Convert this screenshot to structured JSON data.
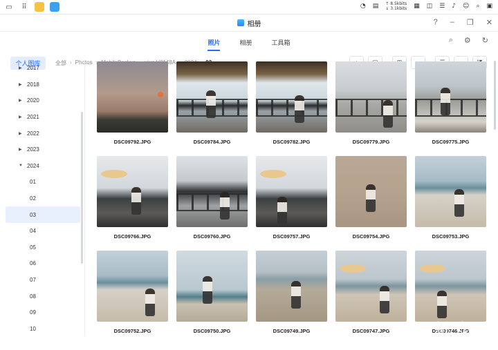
{
  "window": {
    "title": "相册"
  },
  "tabs": [
    {
      "label": "照片",
      "active": true
    },
    {
      "label": "相册",
      "active": false
    },
    {
      "label": "工具箱",
      "active": false
    }
  ],
  "taskbar": {
    "net_up": "↑ 8.5kbits",
    "net_down": "↓ 3.1kbits"
  },
  "sidebar": {
    "library_label": "个人图库",
    "years": [
      "2017",
      "2018",
      "2020",
      "2021",
      "2022",
      "2023",
      "2024"
    ],
    "months_2024": [
      "01",
      "02",
      "03",
      "04",
      "05",
      "06",
      "07",
      "08",
      "09",
      "10"
    ],
    "selected_month": "03"
  },
  "breadcrumb": [
    "全部",
    "Photos",
    "MobileBackup",
    "vivo V2148A",
    "2024",
    "03"
  ],
  "photos": [
    {
      "name": "DSC09792.JPG",
      "scene": "sunset"
    },
    {
      "name": "DSC09784.JPG",
      "scene": "pier-thatch"
    },
    {
      "name": "DSC09782.JPG",
      "scene": "pier-thatch"
    },
    {
      "name": "DSC09779.JPG",
      "scene": "boardwalk"
    },
    {
      "name": "DSC09775.JPG",
      "scene": "pier-sit"
    },
    {
      "name": "DSC09766.JPG",
      "scene": "hat-pier"
    },
    {
      "name": "DSC09760.JPG",
      "scene": "pier-rail"
    },
    {
      "name": "DSC09757.JPG",
      "scene": "hat-pier"
    },
    {
      "name": "DSC09754.JPG",
      "scene": "sand"
    },
    {
      "name": "DSC09753.JPG",
      "scene": "beach"
    },
    {
      "name": "DSC09752.JPG",
      "scene": "beach"
    },
    {
      "name": "DSC09750.JPG",
      "scene": "beach-dress"
    },
    {
      "name": "DSC09749.JPG",
      "scene": "beach-wide"
    },
    {
      "name": "DSC09747.JPG",
      "scene": "hat-beach"
    },
    {
      "name": "DSC09746.JPG",
      "scene": "hat-beach"
    }
  ],
  "watermark": "新 众观",
  "colors": {
    "accent": "#2a6cf6",
    "selected_bg": "#e8f0fe"
  }
}
